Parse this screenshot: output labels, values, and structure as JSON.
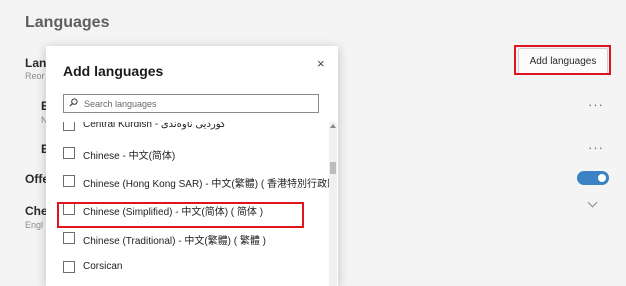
{
  "settings": {
    "section_title": "Languages",
    "row_language_label": "Lang",
    "row_language_sub": "Reor",
    "add_languages_label": "Add languages",
    "row_offer_label": "Offe",
    "row_check_label": "Che",
    "row_check_sub": "Engl",
    "row_e1": "E",
    "row_n": "N",
    "row_e2": "E",
    "more_dots": "···"
  },
  "dialog": {
    "title": "Add languages",
    "close_glyph": "×",
    "search_placeholder": "Search languages",
    "items": [
      {
        "label": "Central Kurdish - کوردیی ناوەندی"
      },
      {
        "label": "Chinese - 中文(简体)"
      },
      {
        "label": "Chinese (Hong Kong SAR) - 中文(繁體) ( 香港特別行政區 )"
      },
      {
        "label": "Chinese (Simplified) - 中文(简体) ( 简体 )"
      },
      {
        "label": "Chinese (Traditional) - 中文(繁體) ( 繁體 )"
      },
      {
        "label": "Corsican"
      }
    ]
  },
  "colors": {
    "highlight": "#e0141c",
    "toggle_on": "#3b82c4"
  }
}
